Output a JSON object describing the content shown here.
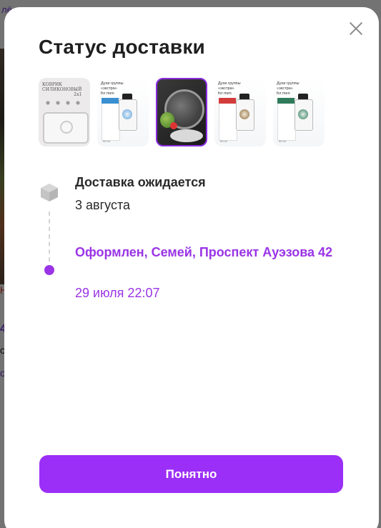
{
  "background": {
    "top_link": "лё",
    "red_text": "Н",
    "blue_num": "4",
    "dark_text": "с",
    "link2": "с"
  },
  "modal": {
    "title": "Статус доставки",
    "close_icon": "close-icon",
    "thumbnails": [
      {
        "name": "silicone-mat",
        "label_line1": "КОВРИК",
        "label_line2": "СИЛИКОНОВЫЙ",
        "label_extra": "2x1"
      },
      {
        "name": "perfume-blue",
        "label_line1": "Духи группы",
        "label_line2": "«экстра»",
        "label_extra": "for men",
        "volume": "50 ml",
        "accent": "#3a8fd0"
      },
      {
        "name": "kitchen-lid",
        "selected": true
      },
      {
        "name": "perfume-red",
        "label_line1": "Духи группы",
        "label_line2": "«экстра»",
        "label_extra": "for men",
        "volume": "50 ml",
        "accent": "#d33b3b"
      },
      {
        "name": "perfume-green",
        "label_line1": "Духи группы",
        "label_line2": "«экстра»",
        "label_extra": "for men",
        "volume": "50 ml",
        "accent": "#2f7a5a"
      }
    ],
    "timeline": [
      {
        "title": "Доставка ожидается",
        "date": "3 августа",
        "icon": "box-icon"
      },
      {
        "title": "Оформлен, Семей, Проспект Ауэзова 42",
        "date": "29 июля 22:07",
        "icon": "dot-icon"
      }
    ],
    "ok_button": "Понятно"
  },
  "colors": {
    "accent": "#9b2ff7",
    "accent_text": "#9a34e6",
    "title": "#1f1f1f"
  }
}
